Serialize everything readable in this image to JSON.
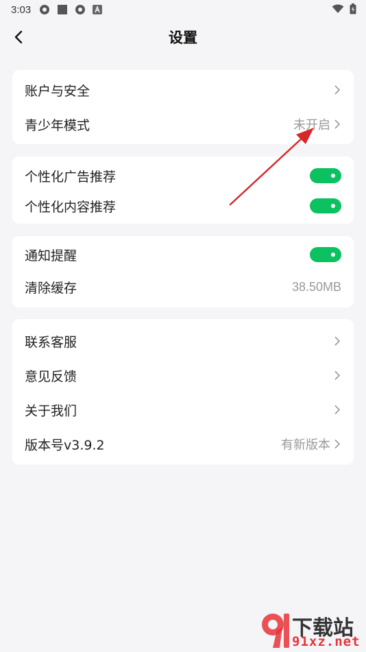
{
  "status_bar": {
    "time": "3:03"
  },
  "header": {
    "title": "设置"
  },
  "group1": {
    "items": [
      {
        "label": "账户与安全",
        "value": ""
      },
      {
        "label": "青少年模式",
        "value": "未开启"
      }
    ]
  },
  "group2": {
    "items": [
      {
        "label": "个性化广告推荐",
        "on": true
      },
      {
        "label": "个性化内容推荐",
        "on": true
      }
    ]
  },
  "group3": {
    "items": [
      {
        "label": "通知提醒",
        "on": true
      },
      {
        "label": "清除缓存",
        "value": "38.50MB"
      }
    ]
  },
  "group4": {
    "items": [
      {
        "label": "联系客服",
        "value": ""
      },
      {
        "label": "意见反馈",
        "value": ""
      },
      {
        "label": "关于我们",
        "value": ""
      },
      {
        "label": "版本号v3.9.2",
        "value": "有新版本"
      }
    ]
  },
  "watermark": {
    "line1": "下载站",
    "line2": "91xz.net"
  },
  "colors": {
    "accent": "#0bc160",
    "background": "#f5f5f7",
    "annotation_arrow": "#d62828"
  }
}
